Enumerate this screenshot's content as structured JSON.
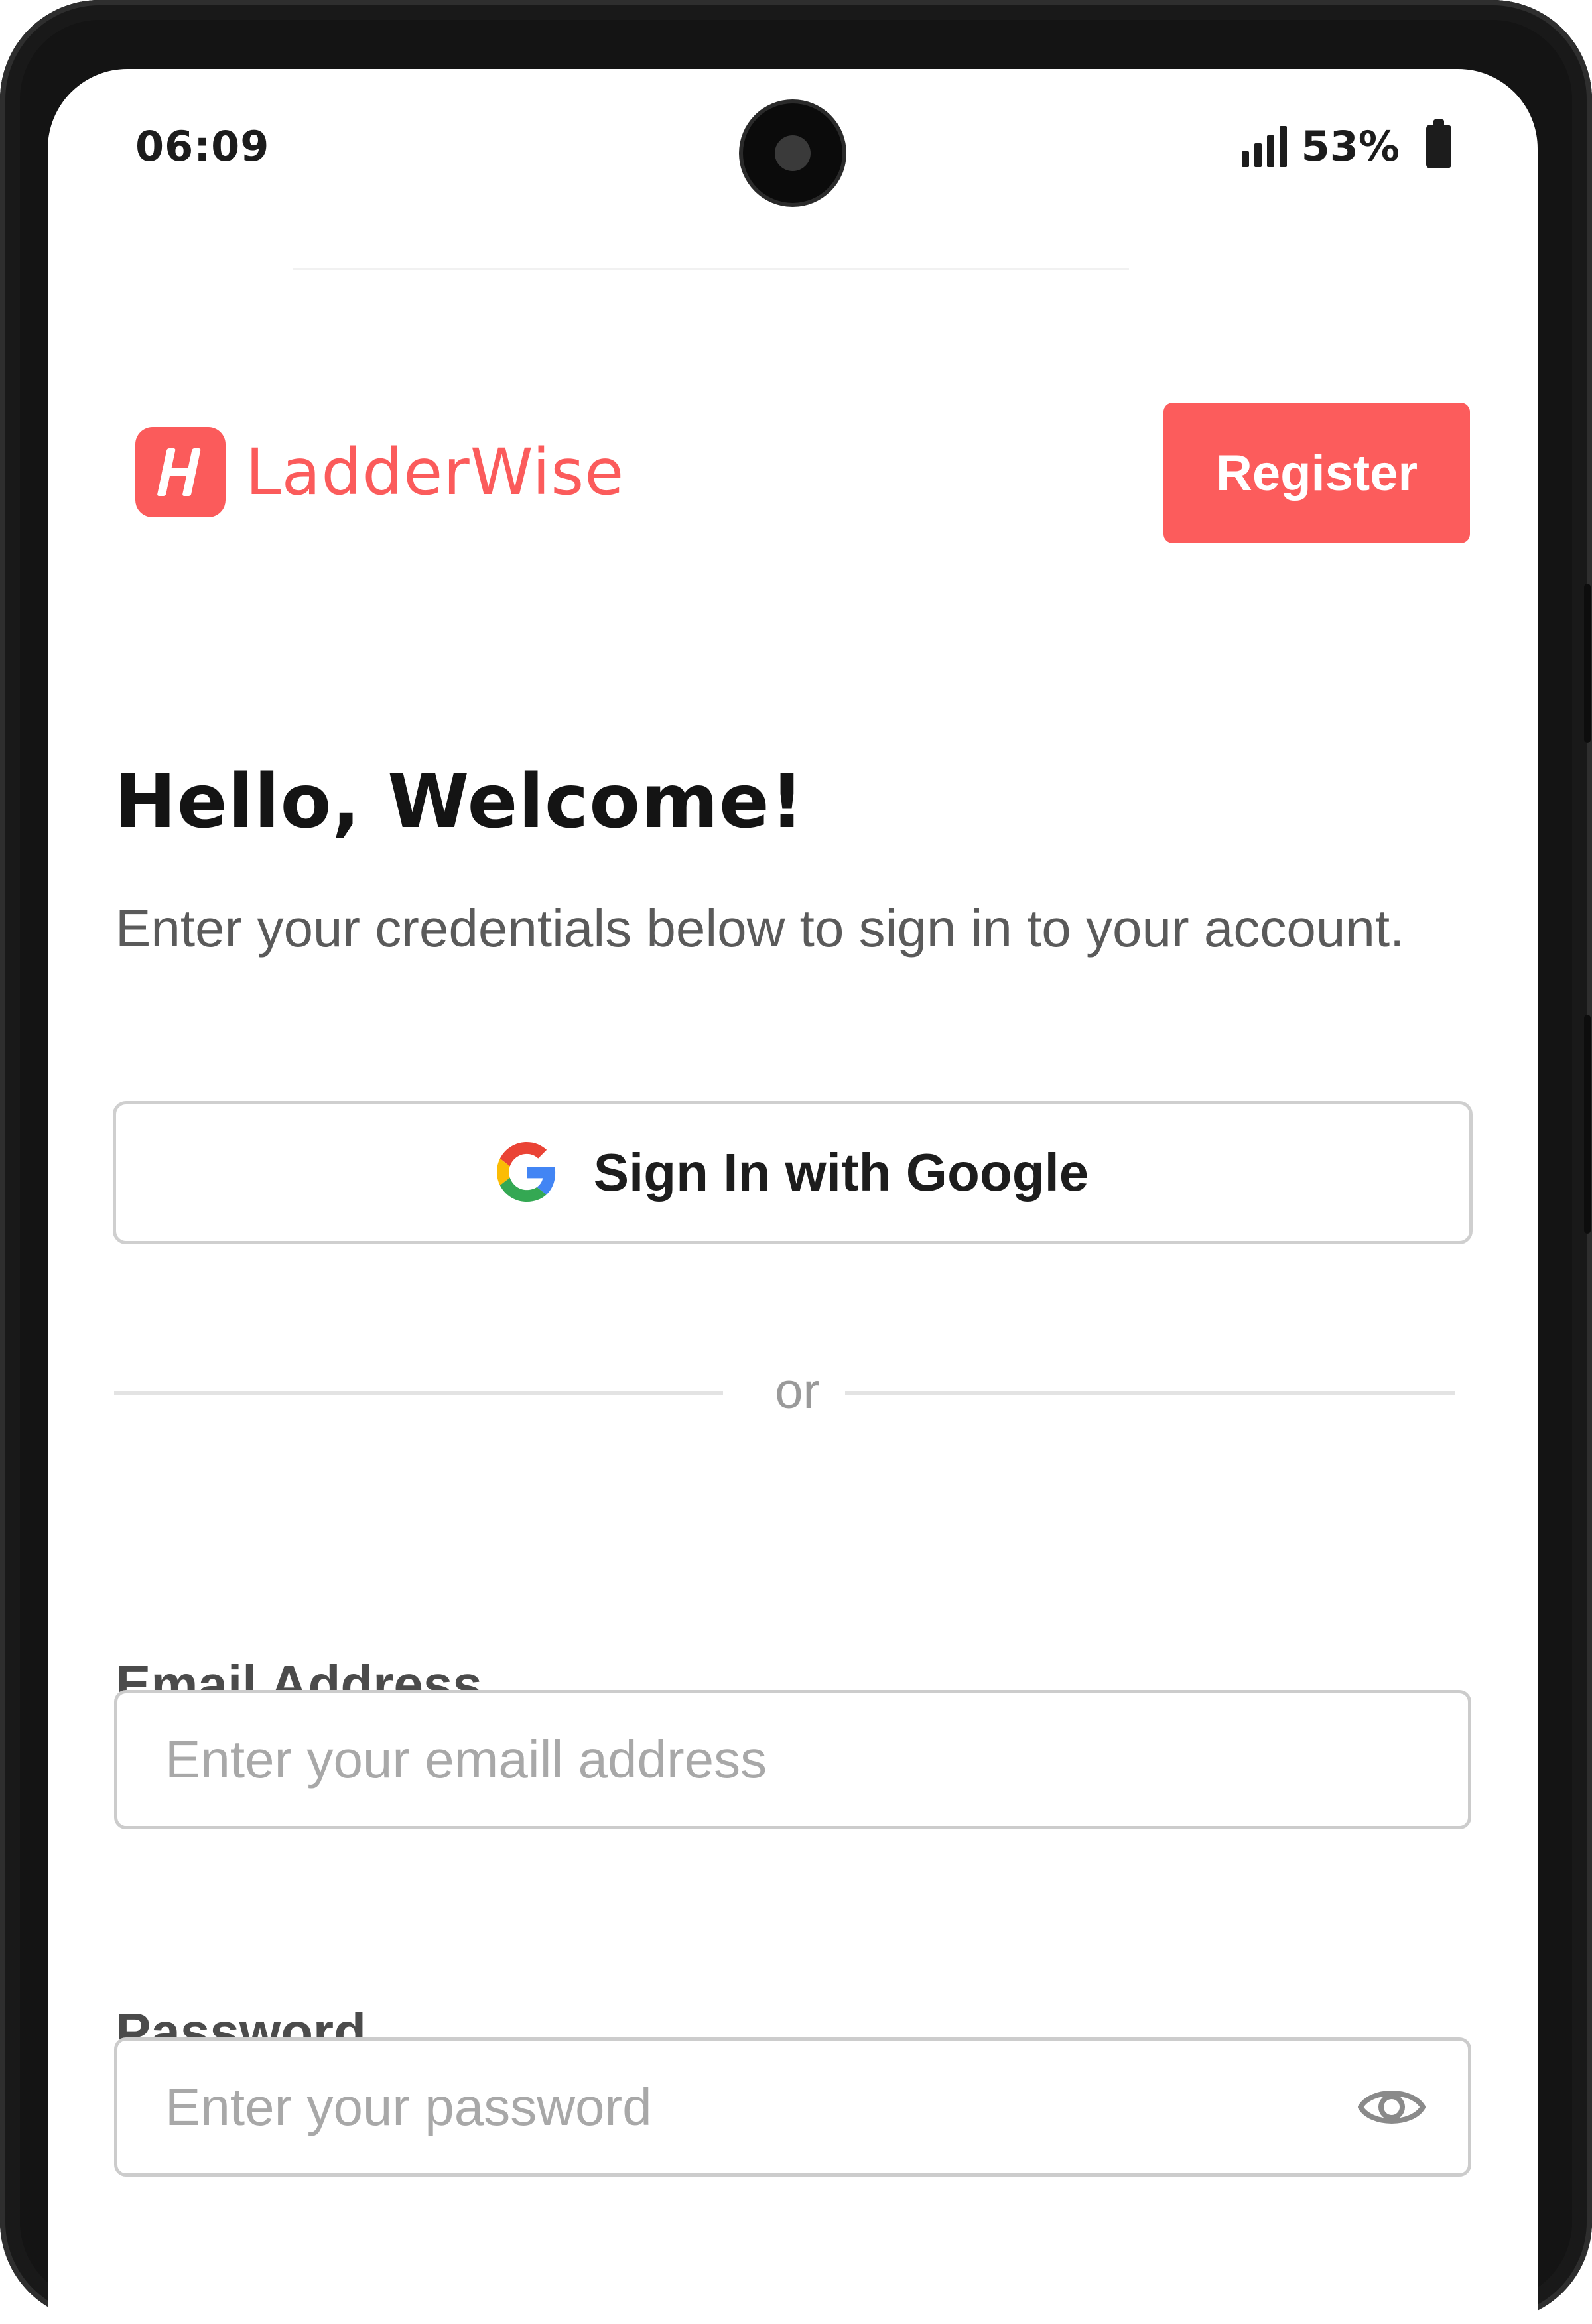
{
  "status_bar": {
    "time": "06:09",
    "battery": "53%",
    "icons": [
      "signal-icon",
      "battery-icon"
    ]
  },
  "header": {
    "brand_name": "LadderWise",
    "logo_icon": "ladderwise-logo-icon",
    "register_label": "Register"
  },
  "welcome": {
    "title": "Hello, Welcome!",
    "subtitle": "Enter your credentials below to sign in to your account."
  },
  "google_signin": {
    "label": "Sign In with Google",
    "icon": "google-icon"
  },
  "divider": {
    "text": "or"
  },
  "form": {
    "email": {
      "label": "Email Address",
      "placeholder": "Enter your emaill address",
      "value": ""
    },
    "password": {
      "label": "Password",
      "placeholder": "Enter your password",
      "value": "",
      "toggle_icon": "eye-icon"
    }
  },
  "colors": {
    "brand": "#FC5C5C",
    "title": "#141414",
    "body_text": "#5A5A5A",
    "label_text": "#4B4B4B",
    "placeholder": "#A8A8A8",
    "border": "#CCCCCC"
  }
}
